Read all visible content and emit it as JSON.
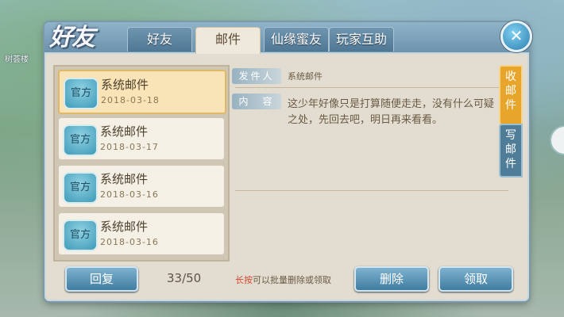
{
  "background": {
    "location_label": "树荟楼"
  },
  "window": {
    "logo_text": "好友"
  },
  "tabs": [
    {
      "label": "好友",
      "active": false
    },
    {
      "label": "邮件",
      "active": true
    },
    {
      "label": "仙缘蜜友",
      "active": false
    },
    {
      "label": "玩家互助",
      "active": false
    }
  ],
  "close_label": "✕",
  "mail_list": [
    {
      "badge": "官方",
      "title": "系统邮件",
      "date": "2018-03-18",
      "selected": true
    },
    {
      "badge": "官方",
      "title": "系统邮件",
      "date": "2018-03-17",
      "selected": false
    },
    {
      "badge": "官方",
      "title": "系统邮件",
      "date": "2018-03-16",
      "selected": false
    },
    {
      "badge": "官方",
      "title": "系统邮件",
      "date": "2018-03-16",
      "selected": false
    }
  ],
  "detail": {
    "sender_label": "发件人",
    "sender_value": "系统邮件",
    "content_label": "内　容",
    "content_text": "这少年好像只是打算随便走走，没有什么可疑之处，先回去吧，明日再来看看。"
  },
  "side_tabs": {
    "inbox": "收邮件",
    "compose": "写邮件"
  },
  "footer": {
    "reply_label": "回复",
    "count": "33/50",
    "hint_key": "长按",
    "hint_rest": "可以批量删除或领取",
    "delete_label": "删除",
    "claim_label": "领取"
  }
}
